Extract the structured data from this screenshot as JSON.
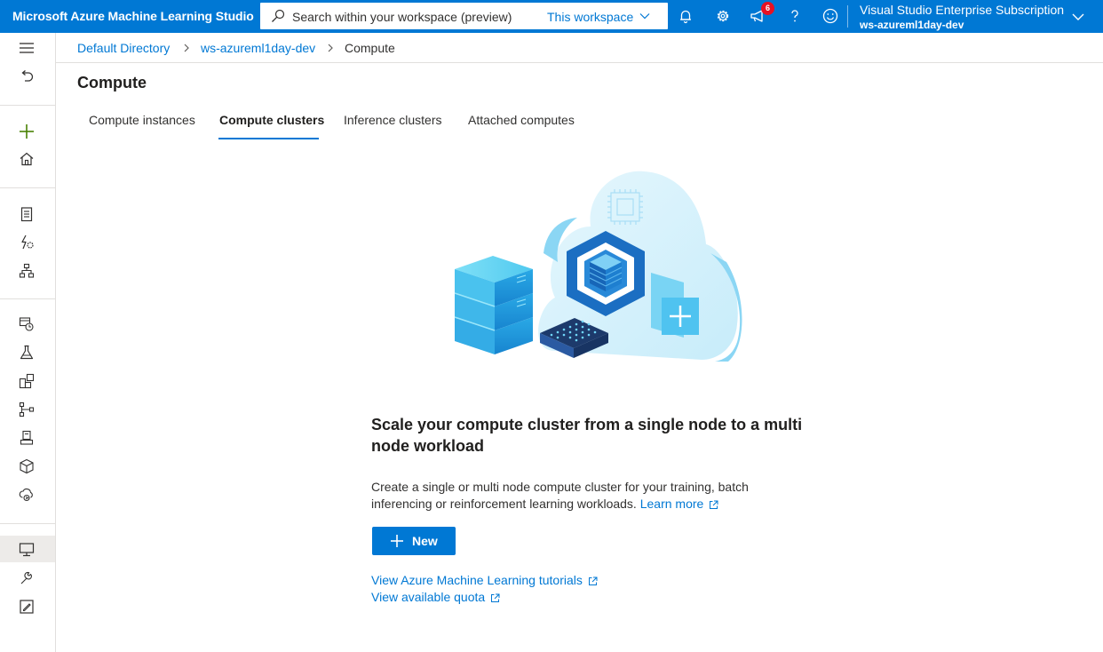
{
  "app": {
    "title": "Microsoft Azure Machine Learning Studio"
  },
  "search": {
    "placeholder": "Search within your workspace (preview)",
    "scope": "This workspace"
  },
  "notifications": {
    "badge_count": "6"
  },
  "account": {
    "subscription": "Visual Studio Enterprise Subscription",
    "workspace": "ws-azureml1day-dev"
  },
  "breadcrumb": {
    "items": [
      "Default Directory",
      "ws-azureml1day-dev",
      "Compute"
    ]
  },
  "page": {
    "title": "Compute"
  },
  "tabs": [
    {
      "label": "Compute instances",
      "active": false
    },
    {
      "label": "Compute clusters",
      "active": true
    },
    {
      "label": "Inference clusters",
      "active": false
    },
    {
      "label": "Attached computes",
      "active": false
    }
  ],
  "empty_state": {
    "headline": "Scale your compute cluster from a single node to a multi node workload",
    "description": "Create a single or multi node compute cluster for your training, batch inferencing or reinforcement learning workloads.",
    "learn_more": "Learn more",
    "new_button": "New",
    "links": [
      "View Azure Machine Learning tutorials",
      "View available quota"
    ]
  },
  "nav": {
    "items": [
      "menu-icon",
      "back-icon",
      "plus-icon",
      "home-icon",
      "notebook-icon",
      "automl-icon",
      "designer-icon",
      "datasets-icon",
      "experiments-icon",
      "pipelines-icon",
      "models-icon",
      "endpoints-icon",
      "environments-icon",
      "linked-services-icon",
      "compute-icon",
      "datastores-icon",
      "data-labeling-icon"
    ],
    "active": "compute-icon"
  },
  "colors": {
    "accent": "#0078d4",
    "badge": "#e81123",
    "active_nav": "#edebe9"
  }
}
